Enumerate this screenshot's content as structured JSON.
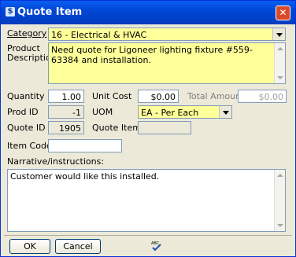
{
  "window": {
    "title": "Quote Item"
  },
  "labels": {
    "category": "Category",
    "product_description": "Product Description",
    "quantity": "Quantity",
    "unit_cost": "Unit Cost",
    "total_amount": "Total Amount",
    "prod_id": "Prod ID",
    "uom": "UOM",
    "quote_id": "Quote ID",
    "quote_item_id": "Quote Item ID",
    "item_code": "Item Code",
    "narrative": "Narrative/instructions:"
  },
  "values": {
    "category": "16 - Electrical & HVAC",
    "product_description": "Need quote for Ligoneer lighting fixture #559-63384 and installation.",
    "quantity": "1.00",
    "unit_cost": "$0.00",
    "total_amount": "$0.00",
    "prod_id": "-1",
    "uom": "EA - Per Each",
    "quote_id": "1905",
    "quote_item_id": "",
    "item_code": "",
    "narrative": "Customer would like this installed."
  },
  "buttons": {
    "ok": "OK",
    "cancel": "Cancel"
  },
  "icons": {
    "app": "app-icon",
    "close": "close-icon",
    "spellcheck": "spellcheck-icon"
  }
}
